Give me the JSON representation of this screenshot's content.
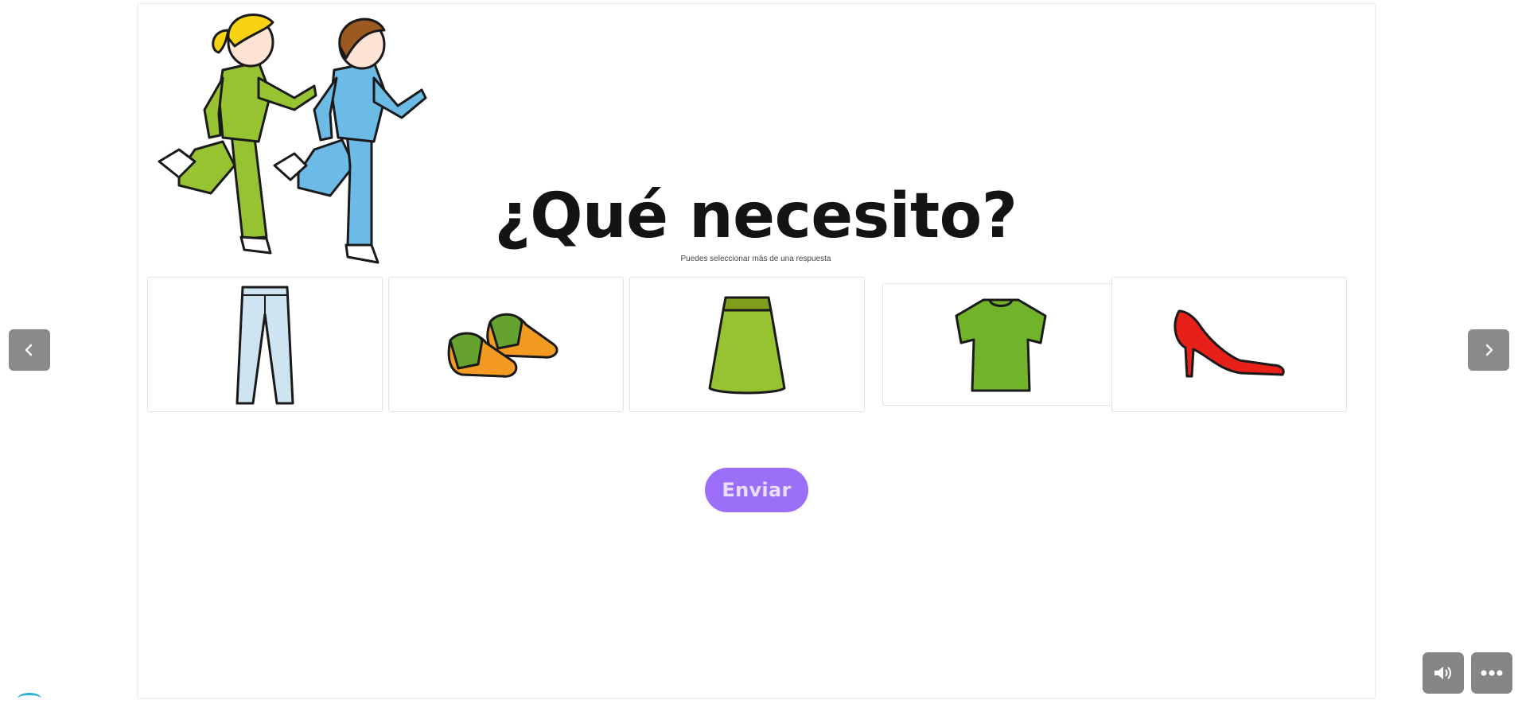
{
  "question": {
    "title": "¿Qué necesito?",
    "subtitle": "Puedes seleccionar más de una respuesta"
  },
  "hero": {
    "icon": "running-children-illustration"
  },
  "options": [
    {
      "icon": "jeans-pants-icon"
    },
    {
      "icon": "sneakers-icon"
    },
    {
      "icon": "green-skirt-icon"
    },
    {
      "icon": "green-tshirt-icon"
    },
    {
      "icon": "red-high-heel-icon"
    }
  ],
  "actions": {
    "submit_label": "Enviar",
    "prev_icon": "chevron-left-icon",
    "next_icon": "chevron-right-icon",
    "audio_icon": "speaker-icon",
    "more_icon": "more-dots-icon"
  },
  "colors": {
    "accent": "#9b6ff8",
    "nav_button": "#8a8a8a",
    "title": "#141414"
  }
}
